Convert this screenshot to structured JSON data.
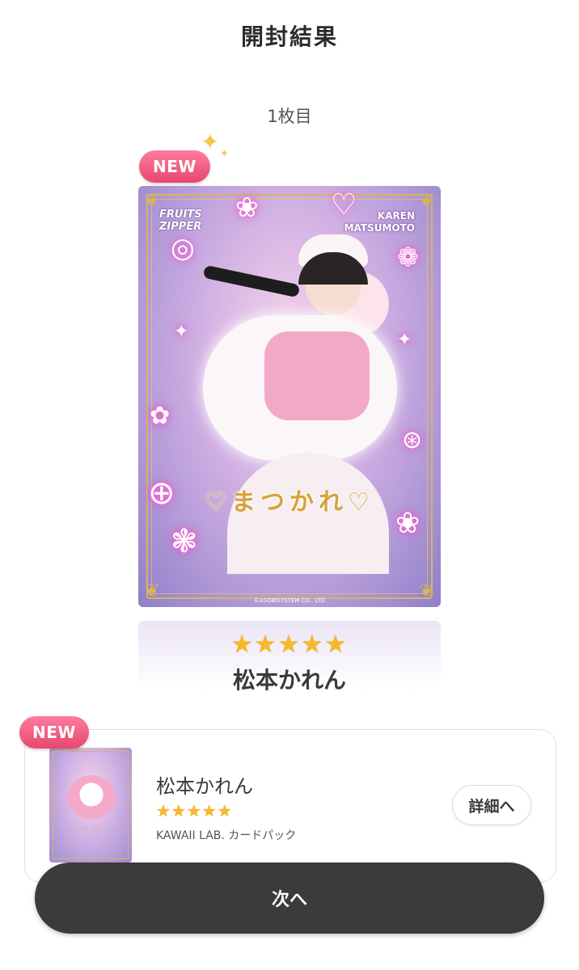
{
  "header": {
    "title": "開封結果"
  },
  "draw": {
    "count_label": "1枚目"
  },
  "card": {
    "badge": "NEW",
    "logo": "FRUITS ZIPPER",
    "name_en_first": "KAREN",
    "name_en_last": "MATSUMOTO",
    "signature": "まつかれ",
    "copyright": "©ASOBISYSTEM CO., LTD",
    "stars": "★★★★★",
    "rarity_stars": 5,
    "member_name": "松本かれん"
  },
  "result_list": {
    "items": [
      {
        "badge": "NEW",
        "name": "松本かれん",
        "stars": "★★★★★",
        "rarity_stars": 5,
        "pack": "KAWAII LAB. カードパック",
        "detail_label": "詳細へ"
      }
    ]
  },
  "footer": {
    "next_label": "次へ"
  },
  "colors": {
    "badge_pink": "#e8476f",
    "star_gold": "#f7b928",
    "button_dark": "#3b3b3b",
    "frame_gold": "#d8b45a"
  }
}
